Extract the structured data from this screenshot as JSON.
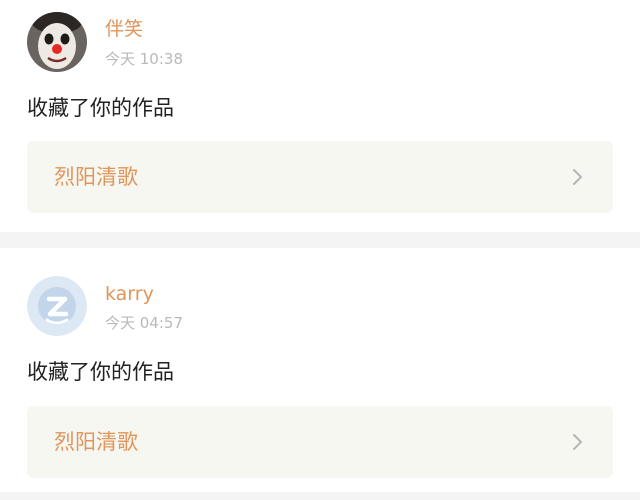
{
  "notifications": [
    {
      "username": "伴笑",
      "timestamp": "今天 10:38",
      "action": "收藏了你的作品",
      "work_title": "烈阳清歌",
      "avatar": "clown-avatar",
      "chevron_icon": "chevron-right-icon"
    },
    {
      "username": "karry",
      "timestamp": "今天 04:57",
      "action": "收藏了你的作品",
      "work_title": "烈阳清歌",
      "avatar": "default-avatar",
      "chevron_icon": "chevron-right-icon"
    }
  ],
  "colors": {
    "username": "#e0955a",
    "work_title": "#e0955a",
    "timestamp": "#b9b9b9",
    "action_text": "#222222",
    "work_link_bg": "#f7f7f2",
    "separator": "#f4f4f4",
    "default_avatar_bg": "#dde8f5"
  }
}
